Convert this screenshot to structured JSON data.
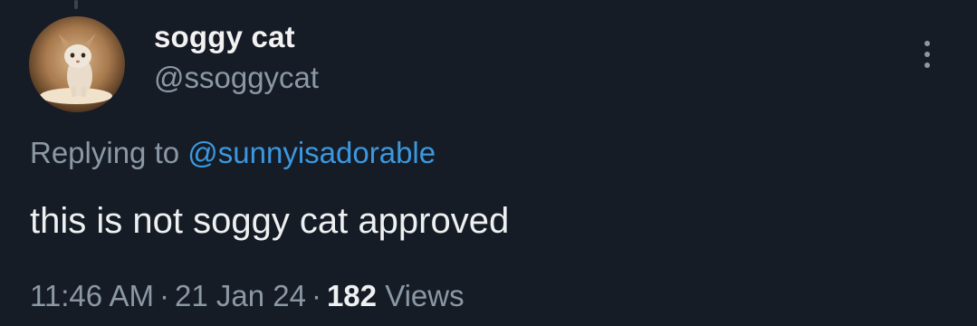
{
  "tweet": {
    "author": {
      "display_name": "soggy cat",
      "handle": "@ssoggycat",
      "avatar": "avatar-cat-photo"
    },
    "more_icon": "more-vertical-icon",
    "replying_prefix": "Replying to",
    "replying_to": "@sunnyisadorable",
    "text": "this is not soggy cat approved",
    "time": "11:46 AM",
    "separator": "·",
    "date": "21 Jan 24",
    "views_count": "182",
    "views_label": "Views"
  },
  "colors": {
    "background": "#161c25",
    "primary_text": "#eef0f1",
    "secondary_text": "#8b98a5",
    "link": "#3b98e0"
  }
}
